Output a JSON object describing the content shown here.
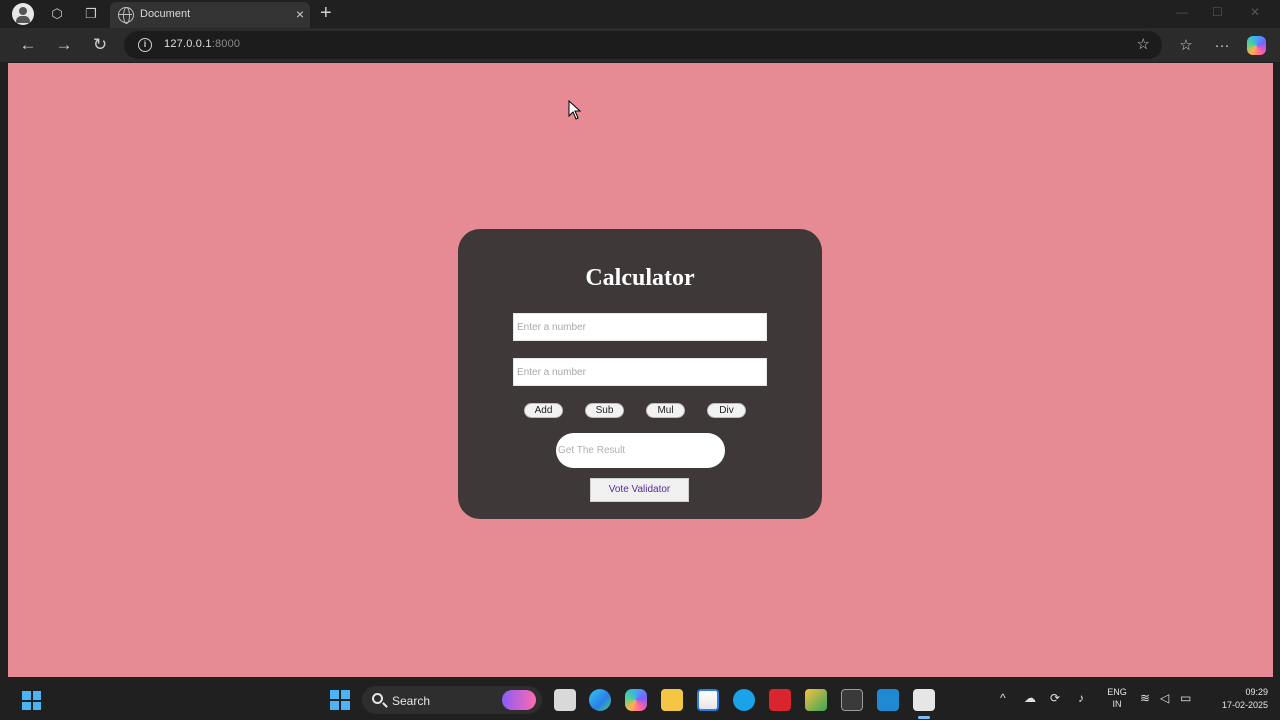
{
  "browser": {
    "tab_title": "Document",
    "tab_close": "×",
    "new_tab": "+",
    "url_host": "127.0.0.1",
    "url_port": ":8000",
    "back": "←",
    "forward": "→",
    "reload": "↻",
    "star": "☆",
    "favorites": "☆",
    "more": "···"
  },
  "calculator": {
    "title": "Calculator",
    "input1_placeholder": "Enter a number",
    "input2_placeholder": "Enter a number",
    "ops": [
      "Add",
      "Sub",
      "Mul",
      "Div"
    ],
    "result_placeholder": "Get The Result",
    "vote_button": "Vote Validator"
  },
  "colors": {
    "page_bg": "#e68a93",
    "card_bg": "#3f3839",
    "title_text": "#ffffff",
    "vote_text": "#5a2aa0"
  },
  "taskbar": {
    "search_label": "Search",
    "lang_line1": "ENG",
    "lang_line2": "IN",
    "time": "09:29",
    "date": "17-02-2025",
    "tray_arrow": "^"
  }
}
